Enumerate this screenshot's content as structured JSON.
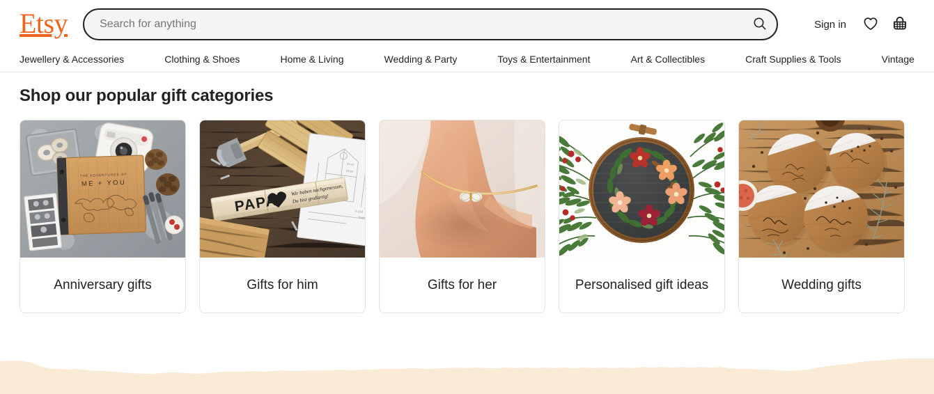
{
  "header": {
    "logo_text": "Etsy",
    "logo_color": "#F1641E",
    "search": {
      "placeholder": "Search for anything",
      "value": "",
      "button_icon": "search-icon",
      "button_label": "Search"
    },
    "sign_in_label": "Sign in",
    "favorites_icon": "heart-icon",
    "cart_icon": "basket-icon"
  },
  "nav": {
    "items": [
      {
        "label": "Jewellery & Accessories"
      },
      {
        "label": "Clothing & Shoes"
      },
      {
        "label": "Home & Living"
      },
      {
        "label": "Wedding & Party"
      },
      {
        "label": "Toys & Entertainment"
      },
      {
        "label": "Art & Collectibles"
      },
      {
        "label": "Craft Supplies & Tools"
      },
      {
        "label": "Vintage"
      }
    ]
  },
  "main": {
    "section_title": "Shop our popular gift categories",
    "cards": [
      {
        "label": "Anniversary gifts",
        "image_alt": "Wooden photo album engraved ME + YOU with instant camera, washi tape and pine cones on concrete"
      },
      {
        "label": "Gifts for him",
        "image_alt": "Engraved wooden folding ruler reading PAPA with hammer and blueprint on rustic wood"
      },
      {
        "label": "Gifts for her",
        "image_alt": "Gold chain anklet with butterfly charm on an ankle"
      },
      {
        "label": "Personalised gift ideas",
        "image_alt": "Embroidery hoop with floral wreath on dark fabric surrounded by evergreen branches"
      },
      {
        "label": "Wedding gifts",
        "image_alt": "Personalised marble and wood coasters engraved with names on a wooden table"
      }
    ]
  },
  "decor": {
    "torn_edge_color": "#FAEBD7"
  }
}
